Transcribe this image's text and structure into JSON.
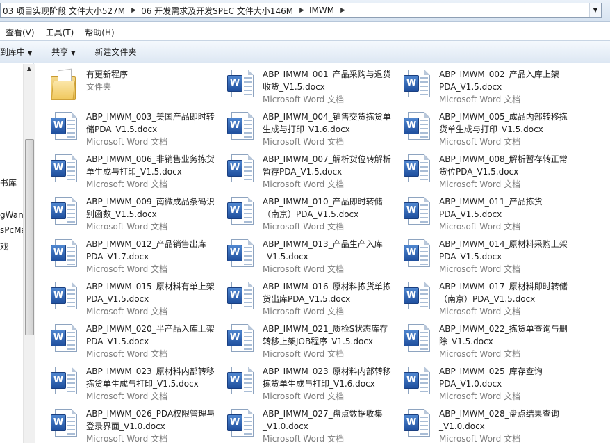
{
  "address_bar": {
    "crumbs": [
      "03 项目实现阶段 文件大小527M",
      "06 开发需求及开发SPEC 文件大小146M",
      "IMWM"
    ]
  },
  "menu": [
    "查看(V)",
    "工具(T)",
    "帮助(H)"
  ],
  "toolbar": {
    "include_label": "到库中",
    "share_label": "共享",
    "new_folder_label": "新建文件夹"
  },
  "nav_fragments": [
    "书库",
    "gWan",
    "sPcMa",
    "戏"
  ],
  "files": [
    {
      "name": "有更新程序",
      "type": "文件夹",
      "icon": "folder-icon"
    },
    {
      "name": "ABP_IMWM_001_产品采购与退货收货_V1.5.docx",
      "type": "Microsoft Word 文档",
      "icon": "word-doc-icon"
    },
    {
      "name": "ABP_IMWM_002_产品入库上架PDA_V1.5.docx",
      "type": "Microsoft Word 文档",
      "icon": "word-doc-icon"
    },
    {
      "name": "ABP_IMWM_003_美国产品即时转储PDA_V1.5.docx",
      "type": "Microsoft Word 文档",
      "icon": "word-doc-icon"
    },
    {
      "name": "ABP_IMWM_004_销售交货拣货单生成与打印_V1.6.docx",
      "type": "Microsoft Word 文档",
      "icon": "word-doc-icon"
    },
    {
      "name": "ABP_IMWM_005_成品内部转移拣货单生成与打印_V1.5.docx",
      "type": "Microsoft Word 文档",
      "icon": "word-doc-icon"
    },
    {
      "name": "ABP_IMWM_006_非销售业务拣货单生成与打印_V1.5.docx",
      "type": "Microsoft Word 文档",
      "icon": "word-doc-icon"
    },
    {
      "name": "ABP_IMWM_007_解析货位转解析暂存PDA_V1.5.docx",
      "type": "Microsoft Word 文档",
      "icon": "word-doc-icon"
    },
    {
      "name": "ABP_IMWM_008_解析暂存转正常货位PDA_V1.5.docx",
      "type": "Microsoft Word 文档",
      "icon": "word-doc-icon"
    },
    {
      "name": "ABP_IMWM_009_南微成品条码识别函数_V1.5.docx",
      "type": "Microsoft Word 文档",
      "icon": "word-doc-icon"
    },
    {
      "name": "ABP_IMWM_010_产品即时转储（南京）PDA_V1.5.docx",
      "type": "Microsoft Word 文档",
      "icon": "word-doc-icon"
    },
    {
      "name": "ABP_IMWM_011_产品拣货PDA_V1.5.docx",
      "type": "Microsoft Word 文档",
      "icon": "word-doc-icon"
    },
    {
      "name": "ABP_IMWM_012_产品销售出库PDA_V1.7.docx",
      "type": "Microsoft Word 文档",
      "icon": "word-doc-icon"
    },
    {
      "name": "ABP_IMWM_013_产品生产入库_V1.5.docx",
      "type": "Microsoft Word 文档",
      "icon": "word-doc-icon"
    },
    {
      "name": "ABP_IMWM_014_原材料采购上架PDA_V1.5.docx",
      "type": "Microsoft Word 文档",
      "icon": "word-doc-icon"
    },
    {
      "name": "ABP_IMWM_015_原材料有单上架PDA_V1.5.docx",
      "type": "Microsoft Word 文档",
      "icon": "word-doc-icon"
    },
    {
      "name": "ABP_IMWM_016_原材料拣货单拣货出库PDA_V1.5.docx",
      "type": "Microsoft Word 文档",
      "icon": "word-doc-icon"
    },
    {
      "name": "ABP_IMWM_017_原材料即时转储（南京）PDA_V1.5.docx",
      "type": "Microsoft Word 文档",
      "icon": "word-doc-icon"
    },
    {
      "name": "ABP_IMWM_020_半产品入库上架PDA_V1.5.docx",
      "type": "Microsoft Word 文档",
      "icon": "word-doc-icon"
    },
    {
      "name": "ABP_IMWM_021_质检S状态库存转移上架JOB程序_V1.5.docx",
      "type": "Microsoft Word 文档",
      "icon": "word-doc-icon"
    },
    {
      "name": "ABP_IMWM_022_拣货单查询与删除_V1.5.docx",
      "type": "Microsoft Word 文档",
      "icon": "word-doc-icon"
    },
    {
      "name": "ABP_IMWM_023_原材料内部转移拣货单生成与打印_V1.5.docx",
      "type": "Microsoft Word 文档",
      "icon": "word-doc-icon"
    },
    {
      "name": "ABP_IMWM_023_原材料内部转移拣货单生成与打印_V1.6.docx",
      "type": "Microsoft Word 文档",
      "icon": "word-doc-icon"
    },
    {
      "name": "ABP_IMWM_025_库存查询PDA_V1.0.docx",
      "type": "Microsoft Word 文档",
      "icon": "word-doc-icon"
    },
    {
      "name": "ABP_IMWM_026_PDA权限管理与登录界面_V1.0.docx",
      "type": "Microsoft Word 文档",
      "icon": "word-doc-icon"
    },
    {
      "name": "ABP_IMWM_027_盘点数据收集_V1.0.docx",
      "type": "Microsoft Word 文档",
      "icon": "word-doc-icon"
    },
    {
      "name": "ABP_IMWM_028_盘点结果查询_V1.0.docx",
      "type": "Microsoft Word 文档",
      "icon": "word-doc-icon"
    }
  ]
}
